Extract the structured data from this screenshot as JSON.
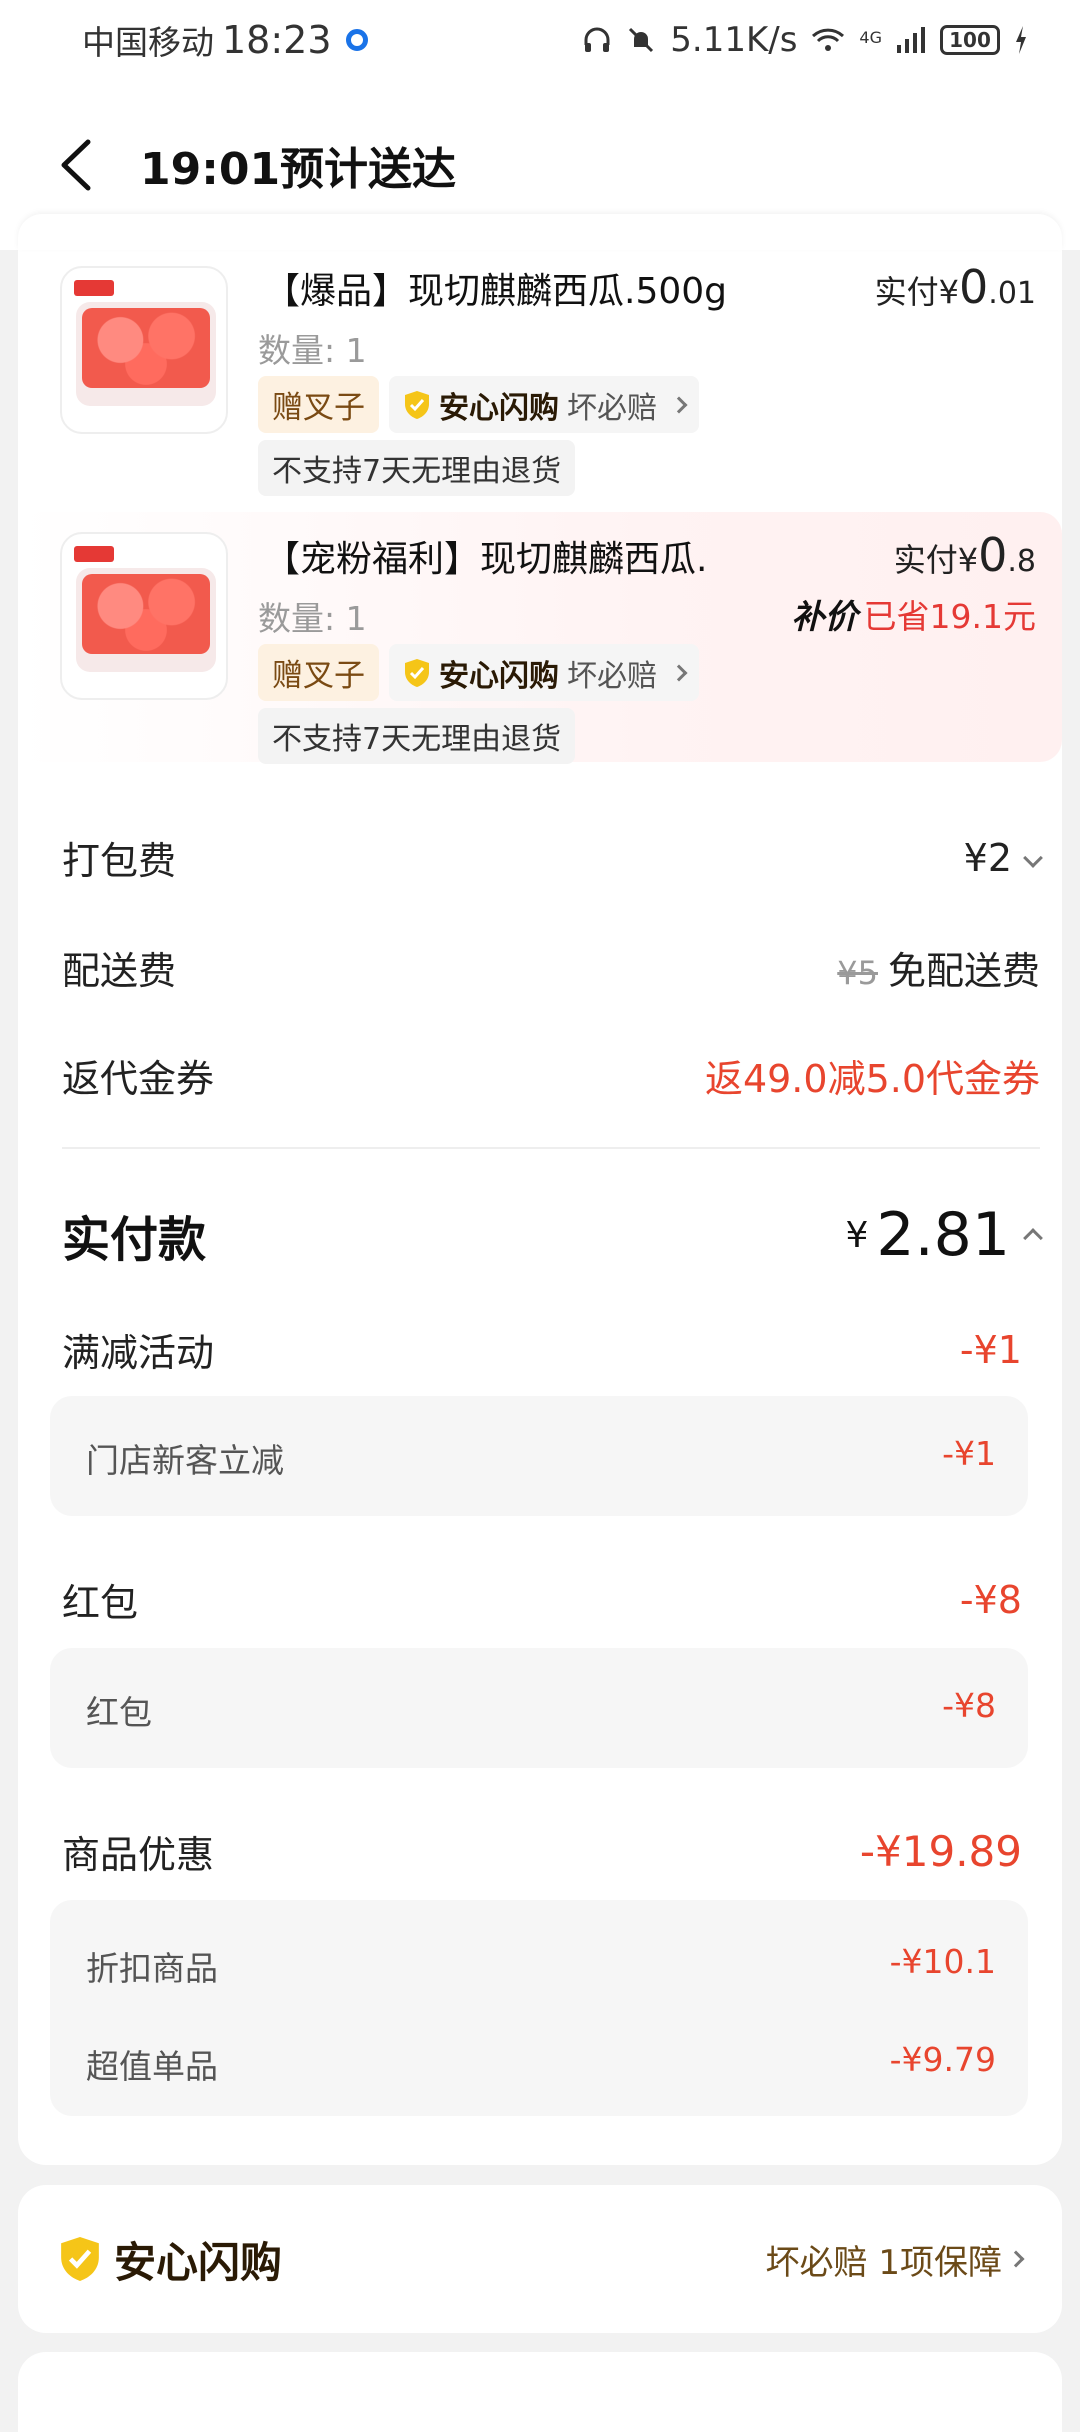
{
  "status_bar": {
    "carrier": "中国移动",
    "time": "18:23",
    "net_speed": "5.11K/s",
    "network": "4G",
    "battery": "100"
  },
  "nav": {
    "title": "19:01预计送达"
  },
  "items": [
    {
      "name": "【爆品】现切麒麟西瓜.500g",
      "qty": "数量: 1",
      "price_prefix": "实付",
      "price_yen": "¥",
      "price_int": "0",
      "price_dec": ".01",
      "gift_tag": "赠叉子",
      "safe_tag": "安心闪购",
      "safe_sub": "坏必赔",
      "refund_note": "不支持7天无理由退货",
      "thumb_logo": "京果园"
    },
    {
      "name": "【宠粉福利】现切麒麟西瓜.",
      "qty": "数量: 1",
      "price_prefix": "实付",
      "price_yen": "¥",
      "price_int": "0",
      "price_dec": ".8",
      "badge": "补价",
      "saved": "已省19.1元",
      "gift_tag": "赠叉子",
      "safe_tag": "安心闪购",
      "safe_sub": "坏必赔",
      "refund_note": "不支持7天无理由退货",
      "thumb_logo": "京果园"
    }
  ],
  "fees": {
    "packing_label": "打包费",
    "packing_value": "¥2",
    "delivery_label": "配送费",
    "delivery_original": "¥5",
    "delivery_value": "免配送费",
    "coupon_label": "返代金券",
    "coupon_value": "返49.0减5.0代金券"
  },
  "total": {
    "label": "实付款",
    "yen": "¥",
    "amount": "2.81"
  },
  "discounts": {
    "full_reduce_label": "满减活动",
    "full_reduce_value": "-¥1",
    "full_reduce_detail_label": "门店新客立减",
    "full_reduce_detail_value": "-¥1",
    "redpack_label": "红包",
    "redpack_value": "-¥8",
    "redpack_detail_label": "红包",
    "redpack_detail_value": "-¥8",
    "goods_label": "商品优惠",
    "goods_value": "-¥19.89",
    "goods_detail": [
      {
        "label": "折扣商品",
        "value": "-¥10.1"
      },
      {
        "label": "超值单品",
        "value": "-¥9.79"
      }
    ]
  },
  "assurance": {
    "title": "安心闪购",
    "right_text": "坏必赔 1项保障"
  },
  "colors": {
    "accent_red": "#e8452e",
    "gift_tag_bg": "#fdf1e1",
    "shield_yellow": "#f5c518"
  }
}
